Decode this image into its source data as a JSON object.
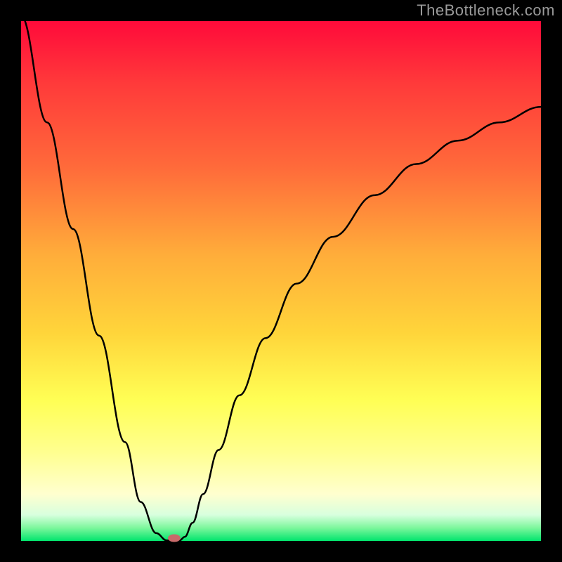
{
  "watermark": "TheBottleneck.com",
  "chart_data": {
    "type": "line",
    "title": "",
    "xlabel": "",
    "ylabel": "",
    "xlim": [
      0,
      100
    ],
    "ylim": [
      0,
      100
    ],
    "background_gradient": {
      "top": "#ff0a3a",
      "bottom": "#00e56d"
    },
    "series": [
      {
        "name": "curve",
        "x": [
          0,
          5,
          10,
          15,
          20,
          23,
          26,
          28,
          29.5,
          30.5,
          31.5,
          33,
          35,
          38,
          42,
          47,
          53,
          60,
          68,
          76,
          84,
          92,
          100
        ],
        "y": [
          101,
          80.5,
          60,
          39.5,
          19,
          7.5,
          1.5,
          0.1,
          0,
          0.1,
          0.8,
          3.5,
          9,
          17.5,
          28,
          39,
          49.5,
          58.5,
          66.5,
          72.5,
          77,
          80.5,
          83.5
        ],
        "color": "#000000"
      }
    ],
    "marker": {
      "x": 29.5,
      "y": 0.5,
      "color": "#c86a6a"
    }
  }
}
